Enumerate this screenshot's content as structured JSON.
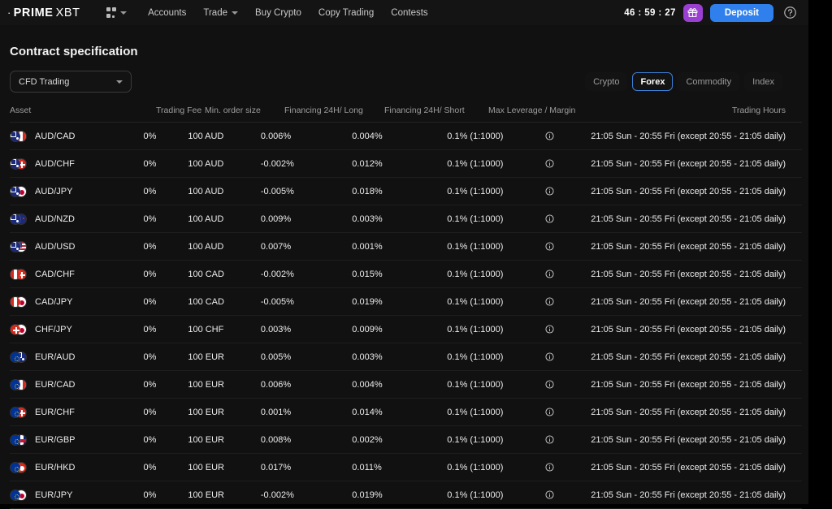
{
  "header": {
    "logo_dot": "·",
    "logo_prime": "PRIME",
    "logo_xbt": "XBT",
    "grid_icon": "apps-grid-icon",
    "nav": [
      {
        "label": "Accounts",
        "has_caret": false
      },
      {
        "label": "Trade",
        "has_caret": true
      },
      {
        "label": "Buy Crypto",
        "has_caret": false
      },
      {
        "label": "Copy Trading",
        "has_caret": false
      },
      {
        "label": "Contests",
        "has_caret": false
      }
    ],
    "timer": "46 : 59 : 27",
    "gift_icon": "gift-icon",
    "deposit_label": "Deposit",
    "help_icon": "help-circle-icon",
    "profile_icon": "user-avatar-icon",
    "accent_blue": "#2F80ED",
    "accent_purple": "#9A3FD1"
  },
  "page": {
    "title": "Contract specification",
    "account_select": {
      "value": "CFD Trading"
    },
    "tabs": [
      {
        "label": "Crypto",
        "active": false
      },
      {
        "label": "Forex",
        "active": true
      },
      {
        "label": "Commodity",
        "active": false
      },
      {
        "label": "Index",
        "active": false
      }
    ],
    "active_tab_border": "#3A7FD5"
  },
  "table": {
    "columns": {
      "asset": "Asset",
      "trading_fee": "Trading Fee",
      "min_order_size": "Min. order size",
      "financing_long": "Financing 24H/ Long",
      "financing_short": "Financing 24H/ Short",
      "max_leverage": "Max Leverage / Margin",
      "trading_hours": "Trading Hours"
    },
    "rows": [
      {
        "asset": "AUD/CAD",
        "base": "au",
        "quote": "ca",
        "fee": "0%",
        "size": "100 AUD",
        "long": "0.006%",
        "short": "0.004%",
        "leverage": "0.1% (1:1000)",
        "hours": "21:05 Sun - 20:55 Fri (except 20:55 - 21:05 daily)"
      },
      {
        "asset": "AUD/CHF",
        "base": "au",
        "quote": "ch",
        "fee": "0%",
        "size": "100 AUD",
        "long": "-0.002%",
        "short": "0.012%",
        "leverage": "0.1% (1:1000)",
        "hours": "21:05 Sun - 20:55 Fri (except 20:55 - 21:05 daily)"
      },
      {
        "asset": "AUD/JPY",
        "base": "au",
        "quote": "jp",
        "fee": "0%",
        "size": "100 AUD",
        "long": "-0.005%",
        "short": "0.018%",
        "leverage": "0.1% (1:1000)",
        "hours": "21:05 Sun - 20:55 Fri (except 20:55 - 21:05 daily)"
      },
      {
        "asset": "AUD/NZD",
        "base": "au",
        "quote": "nz",
        "fee": "0%",
        "size": "100 AUD",
        "long": "0.009%",
        "short": "0.003%",
        "leverage": "0.1% (1:1000)",
        "hours": "21:05 Sun - 20:55 Fri (except 20:55 - 21:05 daily)"
      },
      {
        "asset": "AUD/USD",
        "base": "au",
        "quote": "us",
        "fee": "0%",
        "size": "100 AUD",
        "long": "0.007%",
        "short": "0.001%",
        "leverage": "0.1% (1:1000)",
        "hours": "21:05 Sun - 20:55 Fri (except 20:55 - 21:05 daily)"
      },
      {
        "asset": "CAD/CHF",
        "base": "ca",
        "quote": "ch",
        "fee": "0%",
        "size": "100 CAD",
        "long": "-0.002%",
        "short": "0.015%",
        "leverage": "0.1% (1:1000)",
        "hours": "21:05 Sun - 20:55 Fri (except 20:55 - 21:05 daily)"
      },
      {
        "asset": "CAD/JPY",
        "base": "ca",
        "quote": "jp",
        "fee": "0%",
        "size": "100 CAD",
        "long": "-0.005%",
        "short": "0.019%",
        "leverage": "0.1% (1:1000)",
        "hours": "21:05 Sun - 20:55 Fri (except 20:55 - 21:05 daily)"
      },
      {
        "asset": "CHF/JPY",
        "base": "ch",
        "quote": "jp",
        "fee": "0%",
        "size": "100 CHF",
        "long": "0.003%",
        "short": "0.009%",
        "leverage": "0.1% (1:1000)",
        "hours": "21:05 Sun - 20:55 Fri (except 20:55 - 21:05 daily)"
      },
      {
        "asset": "EUR/AUD",
        "base": "eu",
        "quote": "au",
        "fee": "0%",
        "size": "100 EUR",
        "long": "0.005%",
        "short": "0.003%",
        "leverage": "0.1% (1:1000)",
        "hours": "21:05 Sun - 20:55 Fri (except 20:55 - 21:05 daily)"
      },
      {
        "asset": "EUR/CAD",
        "base": "eu",
        "quote": "ca",
        "fee": "0%",
        "size": "100 EUR",
        "long": "0.006%",
        "short": "0.004%",
        "leverage": "0.1% (1:1000)",
        "hours": "21:05 Sun - 20:55 Fri (except 20:55 - 21:05 daily)"
      },
      {
        "asset": "EUR/CHF",
        "base": "eu",
        "quote": "ch",
        "fee": "0%",
        "size": "100 EUR",
        "long": "0.001%",
        "short": "0.014%",
        "leverage": "0.1% (1:1000)",
        "hours": "21:05 Sun - 20:55 Fri (except 20:55 - 21:05 daily)"
      },
      {
        "asset": "EUR/GBP",
        "base": "eu",
        "quote": "gb",
        "fee": "0%",
        "size": "100 EUR",
        "long": "0.008%",
        "short": "0.002%",
        "leverage": "0.1% (1:1000)",
        "hours": "21:05 Sun - 20:55 Fri (except 20:55 - 21:05 daily)"
      },
      {
        "asset": "EUR/HKD",
        "base": "eu",
        "quote": "hk",
        "fee": "0%",
        "size": "100 EUR",
        "long": "0.017%",
        "short": "0.011%",
        "leverage": "0.1% (1:1000)",
        "hours": "21:05 Sun - 20:55 Fri (except 20:55 - 21:05 daily)"
      },
      {
        "asset": "EUR/JPY",
        "base": "eu",
        "quote": "jp",
        "fee": "0%",
        "size": "100 EUR",
        "long": "-0.002%",
        "short": "0.019%",
        "leverage": "0.1% (1:1000)",
        "hours": "21:05 Sun - 20:55 Fri (except 20:55 - 21:05 daily)"
      }
    ],
    "info_icon": "info-circle-icon"
  }
}
